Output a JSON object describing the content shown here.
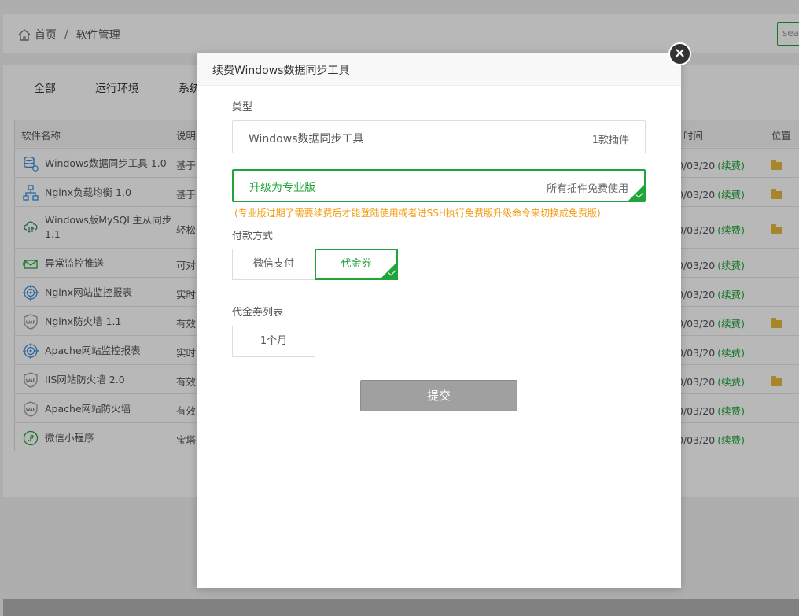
{
  "breadcrumb": {
    "home": "首页",
    "separator": "/",
    "current": "软件管理",
    "home_icon": "home-icon"
  },
  "search": {
    "placeholder": "sea"
  },
  "tabs": [
    "全部",
    "运行环境",
    "系统"
  ],
  "table": {
    "headers": {
      "name": "软件名称",
      "desc": "说明",
      "date": "时间",
      "pos": "位置"
    },
    "rows": [
      {
        "name": "Windows数据同步工具 1.0",
        "desc": "基于r",
        "date": "0/03/20",
        "renew": "(续费)",
        "folder": true,
        "icon": "database-sync-icon"
      },
      {
        "name": "Nginx负载均衡 1.0",
        "desc": "基于r",
        "date": "0/03/20",
        "renew": "(续费)",
        "folder": true,
        "icon": "network-topology-icon"
      },
      {
        "name": "Windows版MySQL主从同步 1.1",
        "desc": "轻松",
        "date": "0/03/20",
        "renew": "(续费)",
        "folder": true,
        "icon": "cloud-sync-icon"
      },
      {
        "name": "异常监控推送",
        "desc": "可对",
        "date": "0/03/20",
        "renew": "(续费)",
        "folder": false,
        "icon": "mail-send-icon"
      },
      {
        "name": "Nginx网站监控报表",
        "desc": "实时",
        "date": "0/03/20",
        "renew": "(续费)",
        "folder": false,
        "icon": "target-monitor-icon"
      },
      {
        "name": "Nginx防火墙 1.1",
        "desc": "有效",
        "date": "0/03/20",
        "renew": "(续费)",
        "folder": true,
        "icon": "waf-shield-icon"
      },
      {
        "name": "Apache网站监控报表",
        "desc": "实时",
        "date": "0/03/20",
        "renew": "(续费)",
        "folder": false,
        "icon": "target-monitor-icon"
      },
      {
        "name": "IIS网站防火墙 2.0",
        "desc": "有效",
        "date": "0/03/20",
        "renew": "(续费)",
        "folder": true,
        "icon": "waf-shield-icon"
      },
      {
        "name": "Apache网站防火墙",
        "desc": "有效",
        "date": "0/03/20",
        "renew": "(续费)",
        "folder": false,
        "icon": "waf-shield-icon"
      },
      {
        "name": "微信小程序",
        "desc": "宝塔",
        "date": "0/03/20",
        "renew": "(续费)",
        "folder": false,
        "icon": "mini-program-icon"
      }
    ]
  },
  "modal": {
    "title": "续费Windows数据同步工具",
    "close_icon": "close-icon",
    "type_label": "类型",
    "option1": {
      "left": "Windows数据同步工具",
      "right": "1款插件"
    },
    "option2": {
      "left": "升级为专业版",
      "right": "所有插件免费使用"
    },
    "note": "(专业版过期了需要续费后才能登陆使用或者进SSH执行免费版升级命令来切换成免费版)",
    "pay_label": "付款方式",
    "pay_wechat": "微信支付",
    "pay_coupon": "代金券",
    "coupon_list_label": "代金券列表",
    "coupon_item": "1个月",
    "submit": "提交"
  },
  "colors": {
    "accent": "#20a53a",
    "warning": "#f39c12",
    "folder": "#e8b93b",
    "submit_disabled": "#a0a0a0"
  }
}
